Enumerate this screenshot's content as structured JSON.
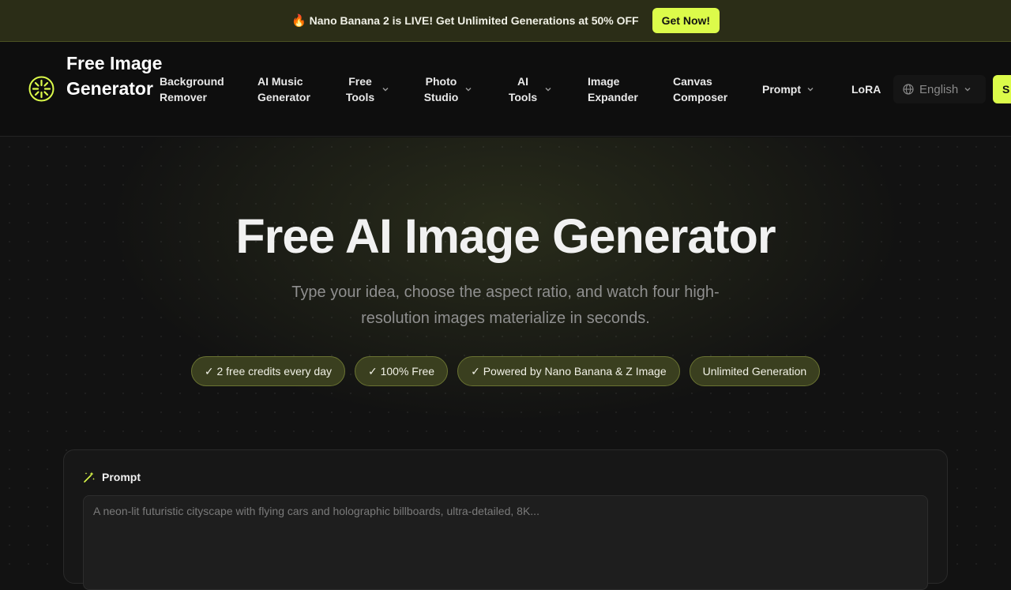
{
  "promo": {
    "icon": "flame-icon",
    "text": "Nano Banana 2 is LIVE! Get Unlimited Generations at 50% OFF",
    "cta": "Get Now!",
    "accent": "#dcfb4a"
  },
  "nav": {
    "logo_icon": "sparkle-logo-icon",
    "logo_text": "Free Image Generator",
    "items": [
      {
        "label": "Background Remover",
        "dropdown": false
      },
      {
        "label": "AI Music Generator",
        "dropdown": false
      },
      {
        "label": "Free Tools",
        "dropdown": true
      },
      {
        "label": "Photo Studio",
        "dropdown": true
      },
      {
        "label": "AI Tools",
        "dropdown": true
      },
      {
        "label": "Image Expander",
        "dropdown": false
      },
      {
        "label": "Canvas Composer",
        "dropdown": false
      },
      {
        "label": "Prompt",
        "dropdown": true
      },
      {
        "label": "LoRA",
        "dropdown": false
      }
    ],
    "language": {
      "icon": "globe-icon",
      "value": "English"
    },
    "cta_partial": "S"
  },
  "hero": {
    "title": "Free AI Image Generator",
    "subtitle": "Type your idea, choose the aspect ratio, and watch four high-resolution images materialize in seconds.",
    "badges": [
      "✓ 2 free credits every day",
      "✓ 100% Free",
      "✓ Powered by Nano Banana & Z Image",
      "Unlimited Generation"
    ]
  },
  "prompt_panel": {
    "icon": "magic-wand-icon",
    "label": "Prompt",
    "placeholder": "A neon-lit futuristic cityscape with flying cars and holographic billboards, ultra-detailed, 8K..."
  }
}
